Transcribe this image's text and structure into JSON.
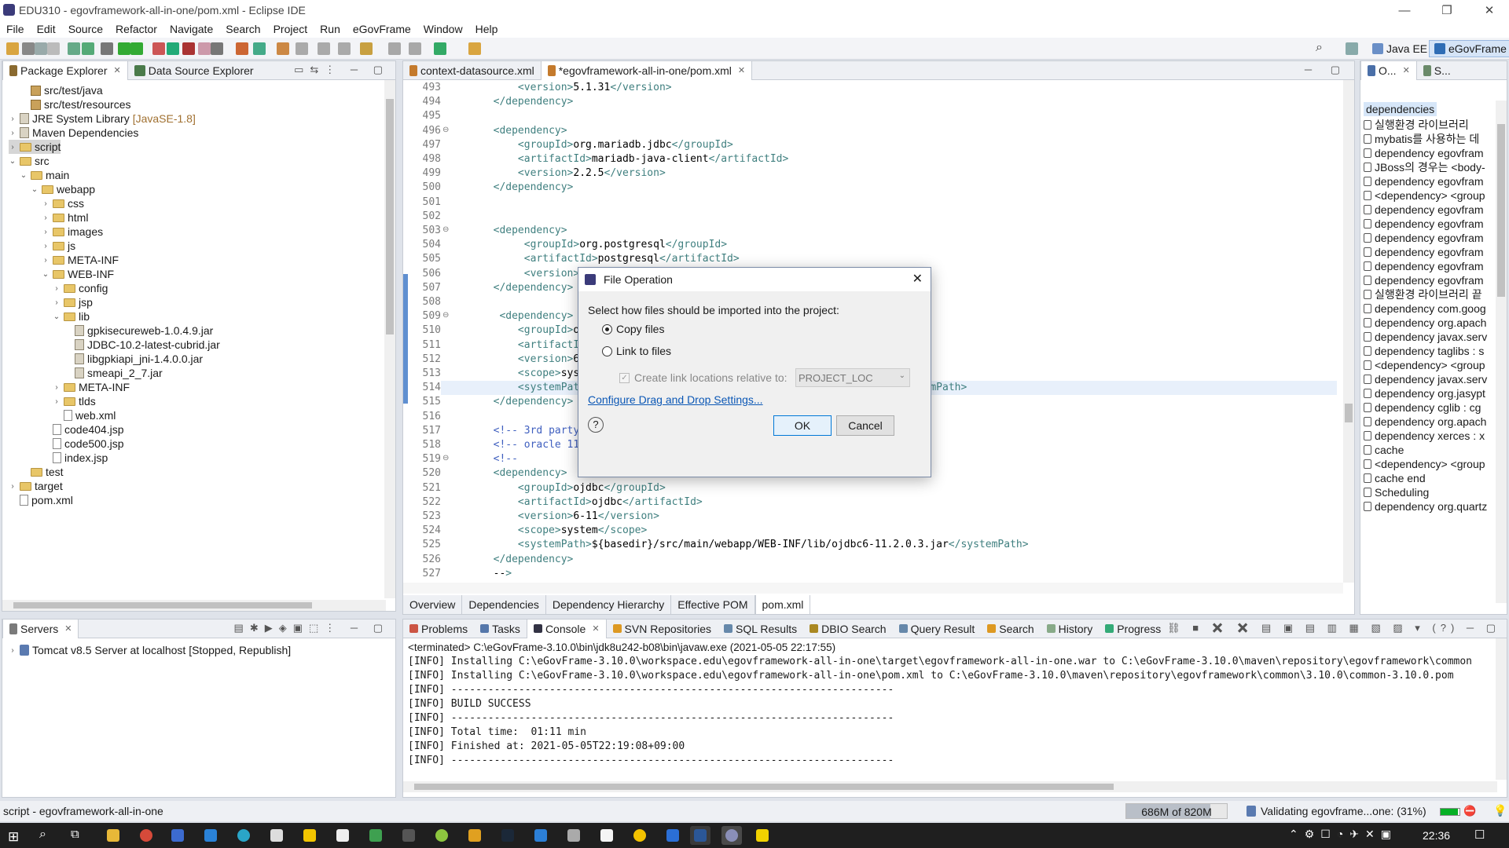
{
  "window": {
    "title": "EDU310 - egovframework-all-in-one/pom.xml - Eclipse IDE",
    "min": "—",
    "max": "❐",
    "close": "✕"
  },
  "menu": [
    "File",
    "Edit",
    "Source",
    "Refactor",
    "Navigate",
    "Search",
    "Project",
    "Run",
    "eGovFrame",
    "Window",
    "Help"
  ],
  "perspectives": {
    "java_ee": "Java EE",
    "egovframe": "eGovFrame"
  },
  "left_tabs": {
    "package_explorer": "Package Explorer",
    "data_source_explorer": "Data Source Explorer"
  },
  "tree": [
    {
      "label": "src/test/java",
      "kind": "pkg",
      "indent": 1
    },
    {
      "label": "src/test/resources",
      "kind": "pkg",
      "indent": 1
    },
    {
      "label": "JRE System Library",
      "suffix": "[JavaSE-1.8]",
      "kind": "lib",
      "indent": 0,
      "chev": "›"
    },
    {
      "label": "Maven Dependencies",
      "kind": "lib",
      "indent": 0,
      "chev": "›"
    },
    {
      "label": "script",
      "kind": "folder",
      "indent": 0,
      "chev": "›",
      "selected": true
    },
    {
      "label": "src",
      "kind": "folder",
      "indent": 0,
      "chev": "⌄"
    },
    {
      "label": "main",
      "kind": "folder",
      "indent": 1,
      "chev": "⌄"
    },
    {
      "label": "webapp",
      "kind": "folder",
      "indent": 2,
      "chev": "⌄"
    },
    {
      "label": "css",
      "kind": "folder",
      "indent": 3,
      "chev": "›"
    },
    {
      "label": "html",
      "kind": "folder",
      "indent": 3,
      "chev": "›"
    },
    {
      "label": "images",
      "kind": "folder",
      "indent": 3,
      "chev": "›"
    },
    {
      "label": "js",
      "kind": "folder",
      "indent": 3,
      "chev": "›"
    },
    {
      "label": "META-INF",
      "kind": "folder",
      "indent": 3,
      "chev": "›"
    },
    {
      "label": "WEB-INF",
      "kind": "folder",
      "indent": 3,
      "chev": "⌄"
    },
    {
      "label": "config",
      "kind": "folder",
      "indent": 4,
      "chev": "›"
    },
    {
      "label": "jsp",
      "kind": "folder",
      "indent": 4,
      "chev": "›"
    },
    {
      "label": "lib",
      "kind": "folder",
      "indent": 4,
      "chev": "⌄"
    },
    {
      "label": "gpkisecureweb-1.0.4.9.jar",
      "kind": "jar",
      "indent": 5
    },
    {
      "label": "JDBC-10.2-latest-cubrid.jar",
      "kind": "jar",
      "indent": 5
    },
    {
      "label": "libgpkiapi_jni-1.4.0.0.jar",
      "kind": "jar",
      "indent": 5
    },
    {
      "label": "smeapi_2_7.jar",
      "kind": "jar",
      "indent": 5
    },
    {
      "label": "META-INF",
      "kind": "folder",
      "indent": 4,
      "chev": "›"
    },
    {
      "label": "tlds",
      "kind": "folder",
      "indent": 4,
      "chev": "›"
    },
    {
      "label": "web.xml",
      "kind": "file",
      "indent": 4
    },
    {
      "label": "code404.jsp",
      "kind": "file",
      "indent": 3
    },
    {
      "label": "code500.jsp",
      "kind": "file",
      "indent": 3
    },
    {
      "label": "index.jsp",
      "kind": "file",
      "indent": 3
    },
    {
      "label": "test",
      "kind": "folder",
      "indent": 1
    },
    {
      "label": "target",
      "kind": "folder",
      "indent": 0,
      "chev": "›"
    },
    {
      "label": "pom.xml",
      "kind": "file",
      "indent": 0
    }
  ],
  "editor_tabs": [
    {
      "label": "context-datasource.xml",
      "active": false
    },
    {
      "label": "*egovframework-all-in-one/pom.xml",
      "active": true
    }
  ],
  "code": [
    {
      "n": "493",
      "t": "            <version>5.1.31</version>"
    },
    {
      "n": "494",
      "t": "        </dependency>"
    },
    {
      "n": "495",
      "t": ""
    },
    {
      "n": "496",
      "t": "        <dependency>",
      "fold": true
    },
    {
      "n": "497",
      "t": "            <groupId>org.mariadb.jdbc</groupId>"
    },
    {
      "n": "498",
      "t": "            <artifactId>mariadb-java-client</artifactId>"
    },
    {
      "n": "499",
      "t": "            <version>2.2.5</version>"
    },
    {
      "n": "500",
      "t": "        </dependency>"
    },
    {
      "n": "501",
      "t": ""
    },
    {
      "n": "502",
      "t": ""
    },
    {
      "n": "503",
      "t": "        <dependency>",
      "fold": true
    },
    {
      "n": "504",
      "t": "             <groupId>org.postgresql</groupId>"
    },
    {
      "n": "505",
      "t": "             <artifactId>postgresql</artifactId>"
    },
    {
      "n": "506",
      "t": "             <version>"
    },
    {
      "n": "507",
      "t": "        </dependency>"
    },
    {
      "n": "508",
      "t": ""
    },
    {
      "n": "509",
      "t": "         <dependency>",
      "fold": true
    },
    {
      "n": "510",
      "t": "            <groupId>o"
    },
    {
      "n": "511",
      "t": "            <artifactI"
    },
    {
      "n": "512",
      "t": "            <version>6"
    },
    {
      "n": "513",
      "t": "            <scope>sys"
    },
    {
      "n": "514",
      "t": "            <systemPat                                              .jar</systemPath>",
      "hl": true
    },
    {
      "n": "515",
      "t": "        </dependency>"
    },
    {
      "n": "516",
      "t": ""
    },
    {
      "n": "517",
      "t": "        <!-- 3rd party"
    },
    {
      "n": "518",
      "t": "        <!-- oracle 11"
    },
    {
      "n": "519",
      "t": "        <!--",
      "fold": true
    },
    {
      "n": "520",
      "t": "        <dependency>"
    },
    {
      "n": "521",
      "t": "            <groupId>ojdbc</groupId>"
    },
    {
      "n": "522",
      "t": "            <artifactId>ojdbc</artifactId>"
    },
    {
      "n": "523",
      "t": "            <version>6-11</version>"
    },
    {
      "n": "524",
      "t": "            <scope>system</scope>"
    },
    {
      "n": "525",
      "t": "            <systemPath>${basedir}/src/main/webapp/WEB-INF/lib/ojdbc6-11.2.0.3.jar</systemPath>"
    },
    {
      "n": "526",
      "t": "        </dependency>"
    },
    {
      "n": "527",
      "t": "        -->"
    }
  ],
  "pom_tabs": [
    "Overview",
    "Dependencies",
    "Dependency Hierarchy",
    "Effective POM",
    "pom.xml"
  ],
  "outline": {
    "tab1": "O...",
    "tab2": "S...",
    "header": "dependencies",
    "items": [
      "실행환경 라이브러리",
      "mybatis를 사용하는 데",
      "dependency  egovfram",
      "JBoss의 경우는 <body-",
      "dependency  egovfram",
      "<dependency> <group",
      "dependency  egovfram",
      "dependency  egovfram",
      "dependency  egovfram",
      "dependency  egovfram",
      "dependency  egovfram",
      "dependency  egovfram",
      "실행환경 라이브러리 끝",
      "dependency  com.goog",
      "dependency  org.apach",
      "dependency  javax.serv",
      "dependency  taglibs : s",
      "<dependency> <group",
      "dependency  javax.serv",
      "dependency  org.jasypt",
      "dependency  cglib : cg",
      "dependency  org.apach",
      "dependency  xerces : x",
      "cache",
      "<dependency> <group",
      "cache end",
      "Scheduling",
      "dependency  org.quartz"
    ]
  },
  "servers": {
    "tab": "Servers",
    "entry": "Tomcat v8.5 Server at localhost   [Stopped, Republish]"
  },
  "bottom_tabs": [
    "Problems",
    "Tasks",
    "Console",
    "SVN Repositories",
    "SQL Results",
    "DBIO Search",
    "Query Result",
    "Search",
    "History",
    "Progress"
  ],
  "console": {
    "header": "<terminated> C:\\eGovFrame-3.10.0\\bin\\jdk8u242-b08\\bin\\javaw.exe (2021-05-05 22:17:55)",
    "lines": [
      "[INFO] Installing C:\\eGovFrame-3.10.0\\workspace.edu\\egovframework-all-in-one\\target\\egovframework-all-in-one.war to C:\\eGovFrame-3.10.0\\maven\\repository\\egovframework\\common",
      "[INFO] Installing C:\\eGovFrame-3.10.0\\workspace.edu\\egovframework-all-in-one\\pom.xml to C:\\eGovFrame-3.10.0\\maven\\repository\\egovframework\\common\\3.10.0\\common-3.10.0.pom",
      "[INFO] ------------------------------------------------------------------------",
      "[INFO] BUILD SUCCESS",
      "[INFO] ------------------------------------------------------------------------",
      "[INFO] Total time:  01:11 min",
      "[INFO] Finished at: 2021-05-05T22:19:08+09:00",
      "[INFO] ------------------------------------------------------------------------"
    ]
  },
  "status": {
    "left": "script - egovframework-all-in-one",
    "heap": "686M of 820M",
    "heap_fraction": 0.837,
    "validating": "Validating egovframe...one: (31%)",
    "validating_fraction": 0.31
  },
  "dialog": {
    "title": "File Operation",
    "prompt": "Select how files should be imported into the project:",
    "copy": "Copy files",
    "link": "Link to files",
    "relative": "Create link locations relative to:",
    "relative_value": "PROJECT_LOC",
    "configure": "Configure Drag and Drop Settings...",
    "ok": "OK",
    "cancel": "Cancel",
    "help": "?"
  },
  "taskbar": {
    "time": "22:36"
  }
}
